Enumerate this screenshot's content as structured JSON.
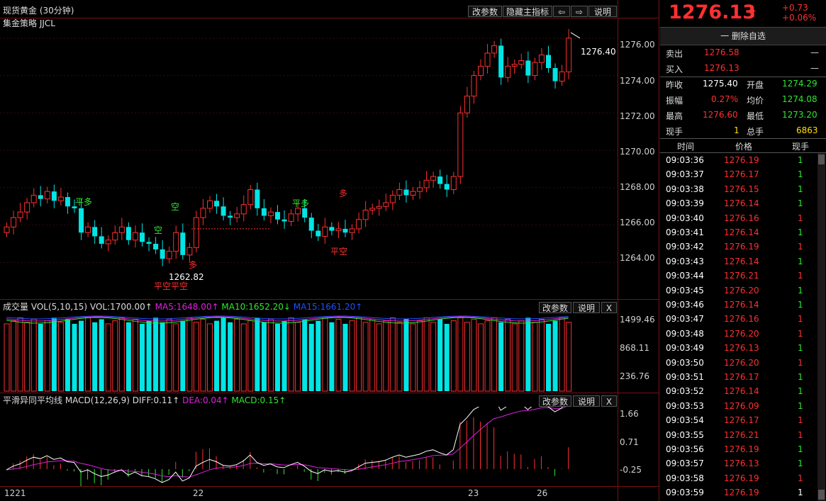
{
  "main": {
    "title": "现货黄金 (30分钟)",
    "strategy": "集金策略 JJCL",
    "buttons": {
      "params": "改参数",
      "hide": "隐藏主指标",
      "left": "⇦",
      "right": "⇨",
      "help": "说明"
    },
    "price_axis": [
      "1276.00",
      "1274.00",
      "1272.00",
      "1270.00",
      "1268.00",
      "1266.00",
      "1264.00"
    ],
    "last_label": "1276.40",
    "low_label": "1262.82",
    "signals": {
      "pingduo1": "平多",
      "kong1": "空",
      "kong2": "空",
      "pingduo2": "平多",
      "duo1": "多",
      "duo2": "多",
      "pingkong1": "平空平空",
      "pingkong2": "平空"
    }
  },
  "volume": {
    "title": "成交量 VOL(5,10,15)",
    "vol": "VOL:1700.00↑",
    "ma5": "MA5:1648.00↑",
    "ma10": "MA10:1652.20↓",
    "ma15": "MA15:1661.20↑",
    "buttons": {
      "params": "改参数",
      "help": "说明",
      "close": "X"
    },
    "axis": [
      "1499.46",
      "868.11",
      "236.76"
    ]
  },
  "macd": {
    "title": "平滑异同平均线 MACD(12,26,9)",
    "diff": "DIFF:0.11↑",
    "dea": "DEA:0.04↑",
    "macd": "MACD:0.15↑",
    "buttons": {
      "params": "改参数",
      "help": "说明",
      "close": "X"
    },
    "axis": [
      "1.66",
      "0.71",
      "-0.25"
    ]
  },
  "dates": [
    "1221",
    "22",
    "23",
    "26"
  ],
  "quote": {
    "price": "1276.13",
    "arrow": "⬆",
    "change": "+0.73",
    "pct": "+0.06%",
    "watch": "一 删除自选",
    "sell_label": "卖出",
    "sell": "1276.58",
    "sell_vol": "—",
    "buy_label": "买入",
    "buy": "1276.13",
    "buy_vol": "—",
    "prev_label": "昨收",
    "prev": "1275.40",
    "open_label": "开盘",
    "open": "1274.29",
    "amp_label": "振幅",
    "amp": "0.27%",
    "avg_label": "均价",
    "avg": "1274.08",
    "high_label": "最高",
    "high": "1276.60",
    "low_label": "最低",
    "low": "1273.20",
    "cur_label": "现手",
    "cur": "1",
    "tot_label": "总手",
    "tot": "6863"
  },
  "ticks": {
    "headers": [
      "时间",
      "价格",
      "现手"
    ],
    "rows": [
      {
        "t": "09:03:36",
        "p": "1276.19",
        "v": "1",
        "c": "dn"
      },
      {
        "t": "09:03:37",
        "p": "1276.17",
        "v": "1",
        "c": "dn"
      },
      {
        "t": "09:03:38",
        "p": "1276.15",
        "v": "1",
        "c": "dn"
      },
      {
        "t": "09:03:39",
        "p": "1276.14",
        "v": "1",
        "c": "dn"
      },
      {
        "t": "09:03:40",
        "p": "1276.16",
        "v": "1",
        "c": "up"
      },
      {
        "t": "09:03:41",
        "p": "1276.14",
        "v": "1",
        "c": "dn"
      },
      {
        "t": "09:03:42",
        "p": "1276.19",
        "v": "1",
        "c": "up"
      },
      {
        "t": "09:03:43",
        "p": "1276.14",
        "v": "1",
        "c": "dn"
      },
      {
        "t": "09:03:44",
        "p": "1276.21",
        "v": "1",
        "c": "up"
      },
      {
        "t": "09:03:45",
        "p": "1276.20",
        "v": "1",
        "c": "dn"
      },
      {
        "t": "09:03:46",
        "p": "1276.14",
        "v": "1",
        "c": "dn"
      },
      {
        "t": "09:03:47",
        "p": "1276.16",
        "v": "1",
        "c": "up"
      },
      {
        "t": "09:03:48",
        "p": "1276.20",
        "v": "1",
        "c": "up"
      },
      {
        "t": "09:03:49",
        "p": "1276.13",
        "v": "1",
        "c": "dn"
      },
      {
        "t": "09:03:50",
        "p": "1276.20",
        "v": "1",
        "c": "up"
      },
      {
        "t": "09:03:51",
        "p": "1276.17",
        "v": "1",
        "c": "dn"
      },
      {
        "t": "09:03:52",
        "p": "1276.14",
        "v": "1",
        "c": "dn"
      },
      {
        "t": "09:03:53",
        "p": "1276.09",
        "v": "1",
        "c": "dn"
      },
      {
        "t": "09:03:54",
        "p": "1276.17",
        "v": "1",
        "c": "up"
      },
      {
        "t": "09:03:55",
        "p": "1276.21",
        "v": "1",
        "c": "up"
      },
      {
        "t": "09:03:56",
        "p": "1276.19",
        "v": "1",
        "c": "dn"
      },
      {
        "t": "09:03:57",
        "p": "1276.13",
        "v": "1",
        "c": "dn"
      },
      {
        "t": "09:03:58",
        "p": "1276.19",
        "v": "1",
        "c": "up"
      },
      {
        "t": "09:03:59",
        "p": "1276.19",
        "v": "1",
        "c": "wh"
      }
    ]
  },
  "chart_data": {
    "type": "candlestick",
    "ylim": [
      1262.5,
      1276.6
    ],
    "candles_close": [
      1265.9,
      1266.4,
      1266.7,
      1267.2,
      1267.6,
      1267.4,
      1267.8,
      1267.3,
      1267.5,
      1267.0,
      1266.9,
      1265.6,
      1265.9,
      1265.4,
      1265.0,
      1265.2,
      1265.6,
      1265.9,
      1265.2,
      1265.6,
      1265.1,
      1265.0,
      1264.7,
      1264.2,
      1264.6,
      1265.6,
      1264.4,
      1264.8,
      1266.4,
      1266.9,
      1267.3,
      1267.0,
      1266.5,
      1266.4,
      1266.6,
      1267.1,
      1267.9,
      1266.9,
      1266.5,
      1266.7,
      1266.3,
      1266.2,
      1266.6,
      1266.9,
      1266.4,
      1265.7,
      1265.4,
      1265.9,
      1265.7,
      1265.8,
      1265.6,
      1265.8,
      1266.3,
      1266.8,
      1266.9,
      1267.0,
      1267.2,
      1267.6,
      1267.9,
      1267.6,
      1267.8,
      1268.0,
      1268.4,
      1268.6,
      1268.2,
      1267.9,
      1268.6,
      1272.0,
      1272.9,
      1274.0,
      1274.5,
      1275.2,
      1275.6,
      1273.9,
      1274.5,
      1274.6,
      1274.8,
      1274.0,
      1274.7,
      1275.1,
      1274.4,
      1273.7,
      1274.2,
      1276.0
    ],
    "vol_axis": [
      1499.46,
      868.11,
      236.76
    ],
    "macd_axis": [
      1.66,
      0.71,
      -0.25
    ]
  }
}
